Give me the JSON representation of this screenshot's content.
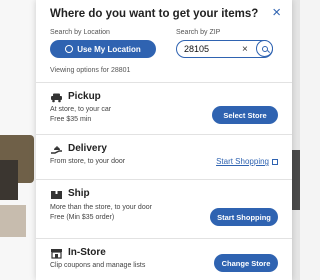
{
  "modal": {
    "title": "Where do you want to get your items?",
    "close_glyph": "×"
  },
  "location": {
    "label": "Search by Location",
    "button_label": "Use My Location"
  },
  "zip": {
    "label": "Search by ZIP",
    "value": "28105",
    "clear_glyph": "×"
  },
  "viewing_text": "Viewing options for 28801",
  "options": {
    "pickup": {
      "title": "Pickup",
      "desc1": "At store, to your car",
      "desc2": "Free $35 min",
      "button": "Select Store"
    },
    "delivery": {
      "title": "Delivery",
      "desc1": "From store, to your door",
      "link": "Start Shopping"
    },
    "ship": {
      "title": "Ship",
      "desc1": "More than the store, to your door",
      "desc2": "Free (Min $35 order)",
      "button": "Start Shopping"
    },
    "instore": {
      "title": "In-Store",
      "desc1": "Clip coupons and manage lists",
      "button": "Change Store"
    }
  },
  "colors": {
    "accent": "#2f63b1",
    "text": "#222222",
    "muted": "#555555"
  },
  "icons": [
    "close-icon",
    "location-pin-icon",
    "clear-icon",
    "search-icon",
    "car-icon",
    "delivery-hand-icon",
    "box-icon",
    "store-icon",
    "external-link-icon"
  ]
}
